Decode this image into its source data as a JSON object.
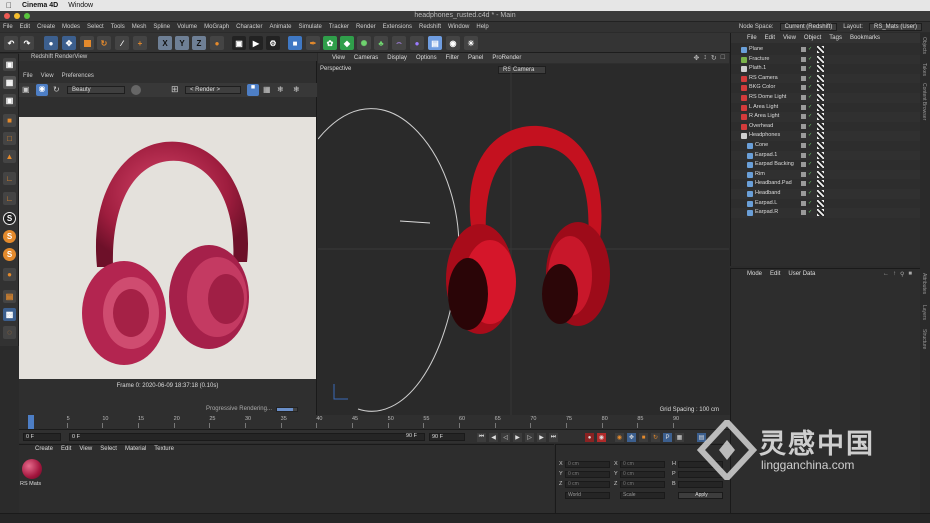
{
  "mac_menu": {
    "app": "Cinema 4D",
    "window": "Window"
  },
  "window": {
    "title": "headphones_rusted.c4d * - Main"
  },
  "menu": {
    "items": [
      "File",
      "Edit",
      "Create",
      "Modes",
      "Select",
      "Tools",
      "Mesh",
      "Spline",
      "Volume",
      "MoGraph",
      "Character",
      "Animate",
      "Simulate",
      "Tracker",
      "Render",
      "Extensions",
      "Redshift",
      "Window",
      "Help"
    ],
    "node_space_label": "Node Space:",
    "node_space_value": "Current (Redshift)",
    "layout_label": "Layout:",
    "layout_value": "RS_Mats (User)"
  },
  "toolbar": {
    "axis_x": "X",
    "axis_y": "Y",
    "axis_z": "Z"
  },
  "left_tools": {
    "s1": "S",
    "s2": "S",
    "s3": "S"
  },
  "renderview": {
    "title": "Redshift RenderView",
    "menu": [
      "File",
      "View",
      "Preferences"
    ],
    "aov": "Beauty",
    "render_dropdown": "< Render >",
    "status": "Frame  0:  2020-06-09  18:37:18  (0.10s)",
    "progress_label": "Progressive Rendering...",
    "progress": 0.8
  },
  "viewport": {
    "menu": [
      "View",
      "Cameras",
      "Display",
      "Options",
      "Filter",
      "Panel",
      "ProRender"
    ],
    "label": "Perspective",
    "camera": "RS Camera",
    "grid_spacing": "Grid Spacing : 100 cm"
  },
  "object_manager": {
    "menu": [
      "File",
      "Edit",
      "View",
      "Object",
      "Tags",
      "Bookmarks"
    ],
    "objects": [
      {
        "name": "Plane",
        "icon": "plane-icon",
        "color": "#6a9fd8"
      },
      {
        "name": "Fracture",
        "icon": "fracture-icon",
        "color": "#7ab34a"
      },
      {
        "name": "Plath.1",
        "icon": "null-icon",
        "color": "#cfcfcf"
      },
      {
        "name": "RS Camera",
        "icon": "camera-icon",
        "color": "#d43b3b"
      },
      {
        "name": "BKG Color",
        "icon": "light-icon",
        "color": "#d43b3b"
      },
      {
        "name": "RS Dome Light",
        "icon": "light-icon",
        "color": "#d43b3b"
      },
      {
        "name": "L Area Light",
        "icon": "light-icon",
        "color": "#d43b3b"
      },
      {
        "name": "R Area Light",
        "icon": "light-icon",
        "color": "#d43b3b"
      },
      {
        "name": "Overhead",
        "icon": "light-icon",
        "color": "#d43b3b"
      },
      {
        "name": "Headphones",
        "icon": "null-icon",
        "color": "#cfcfcf"
      },
      {
        "name": "Cone",
        "icon": "polygon-icon",
        "color": "#6a9fd8"
      },
      {
        "name": "Earpad.1",
        "icon": "polygon-icon",
        "color": "#6a9fd8"
      },
      {
        "name": "Earpad Backing",
        "icon": "polygon-icon",
        "color": "#6a9fd8"
      },
      {
        "name": "Rim",
        "icon": "polygon-icon",
        "color": "#6a9fd8"
      },
      {
        "name": "Headband.Pad",
        "icon": "polygon-icon",
        "color": "#6a9fd8"
      },
      {
        "name": "Headband",
        "icon": "polygon-icon",
        "color": "#6a9fd8"
      },
      {
        "name": "Earpad.L",
        "icon": "polygon-icon",
        "color": "#6a9fd8"
      },
      {
        "name": "Earpad.R",
        "icon": "polygon-icon",
        "color": "#6a9fd8"
      }
    ]
  },
  "attributes": {
    "menu": [
      "Mode",
      "Edit",
      "User Data"
    ]
  },
  "side_tabs": [
    "Objects",
    "Takes",
    "Content Browser",
    "Attributes",
    "Layers",
    "Structure"
  ],
  "timeline": {
    "ticks": [
      "0",
      "5",
      "10",
      "15",
      "20",
      "25",
      "30",
      "35",
      "40",
      "45",
      "50",
      "55",
      "60",
      "65",
      "70",
      "75",
      "80",
      "85",
      "90"
    ],
    "start": "0 F",
    "current": "0 F",
    "end": "90 F",
    "end2": "90 F"
  },
  "material_manager": {
    "menu": [
      "Create",
      "Edit",
      "View",
      "Select",
      "Material",
      "Texture"
    ],
    "material_name": "RS Mats"
  },
  "coordinates": {
    "labels_left": [
      "X",
      "Y",
      "Z"
    ],
    "labels_mid": [
      "X",
      "Y",
      "Z"
    ],
    "labels_right": [
      "H",
      "P",
      "B"
    ],
    "value": "0 cm",
    "world": "World",
    "scale": "Scale",
    "apply": "Apply"
  },
  "watermark": {
    "cn": "灵感中国",
    "url": "lingganchina.com"
  },
  "colors": {
    "accent_blue": "#4d7ec5",
    "headphone_red": "#d11a2a",
    "render_bg": "#e4e1dc"
  }
}
